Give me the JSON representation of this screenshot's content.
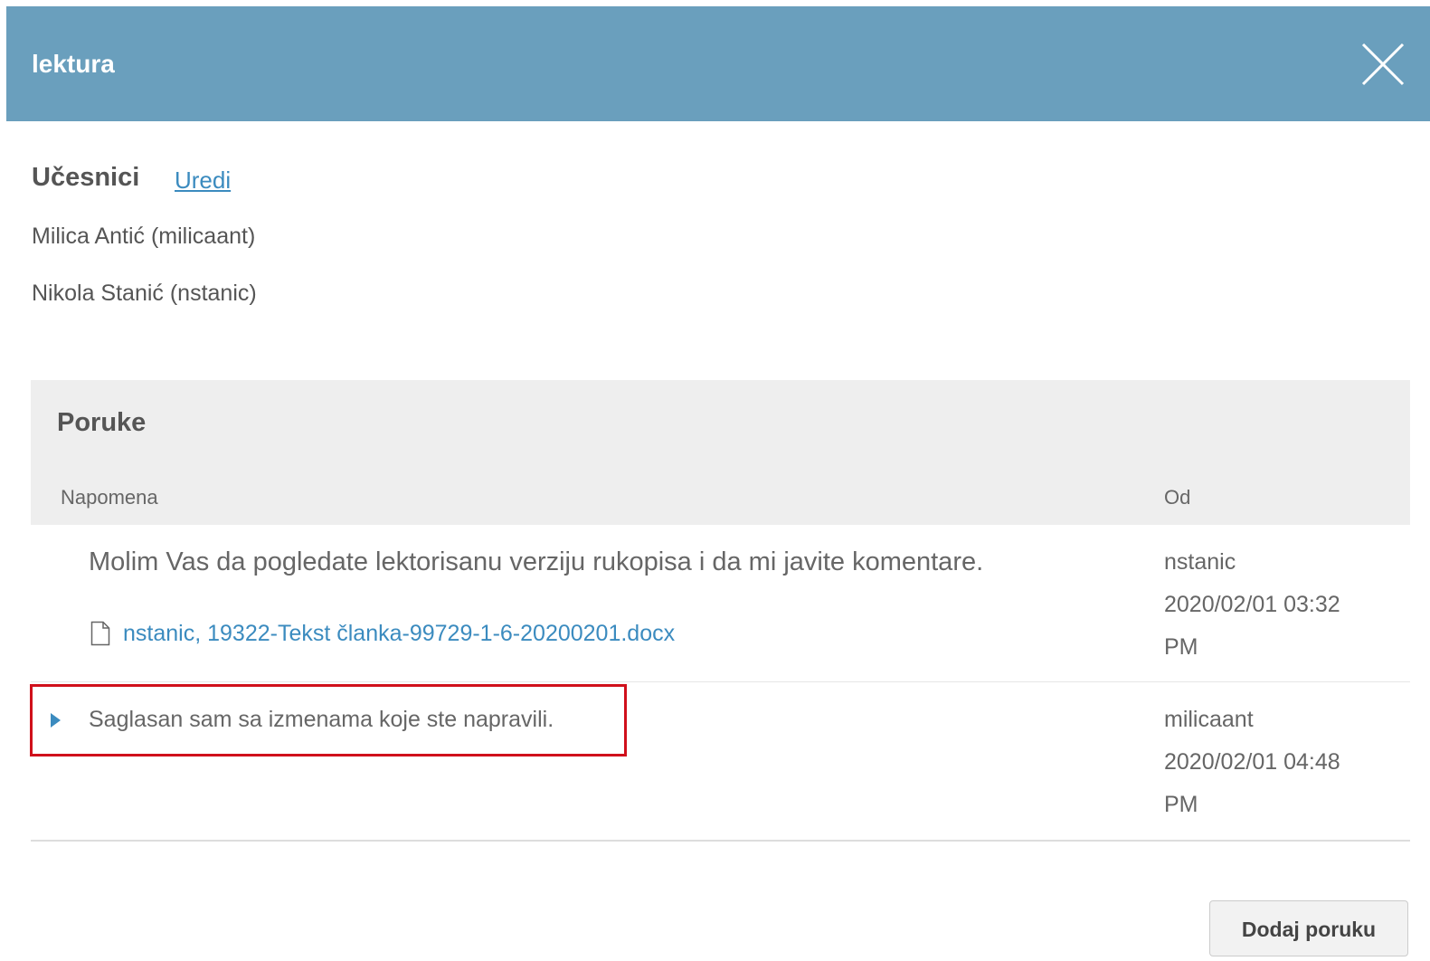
{
  "modal": {
    "title": "lektura",
    "close_icon": "close-icon"
  },
  "participants": {
    "heading": "Učesnici",
    "edit_label": "Uredi",
    "list": [
      "Milica Antić (milicaant)",
      "Nikola Stanić (nstanic)"
    ]
  },
  "messages": {
    "title": "Poruke",
    "columns": {
      "note": "Napomena",
      "from": "Od"
    },
    "rows": [
      {
        "text": "Molim Vas da pogledate lektorisanu verziju rukopisa i da mi javite komentare.",
        "attachment": "nstanic, 19322-Tekst članka-99729-1-6-20200201.docx",
        "author": "nstanic",
        "datetime": "2020/02/01 03:32",
        "ampm": "PM"
      },
      {
        "text": "Saglasan sam sa izmenama koje ste napravili.",
        "author": "milicaant",
        "datetime": "2020/02/01 04:48",
        "ampm": "PM"
      }
    ]
  },
  "actions": {
    "add_message": "Dodaj poruku"
  },
  "colors": {
    "header": "#6a9fbd",
    "link": "#3b8bbf",
    "highlight": "#d0101b"
  }
}
